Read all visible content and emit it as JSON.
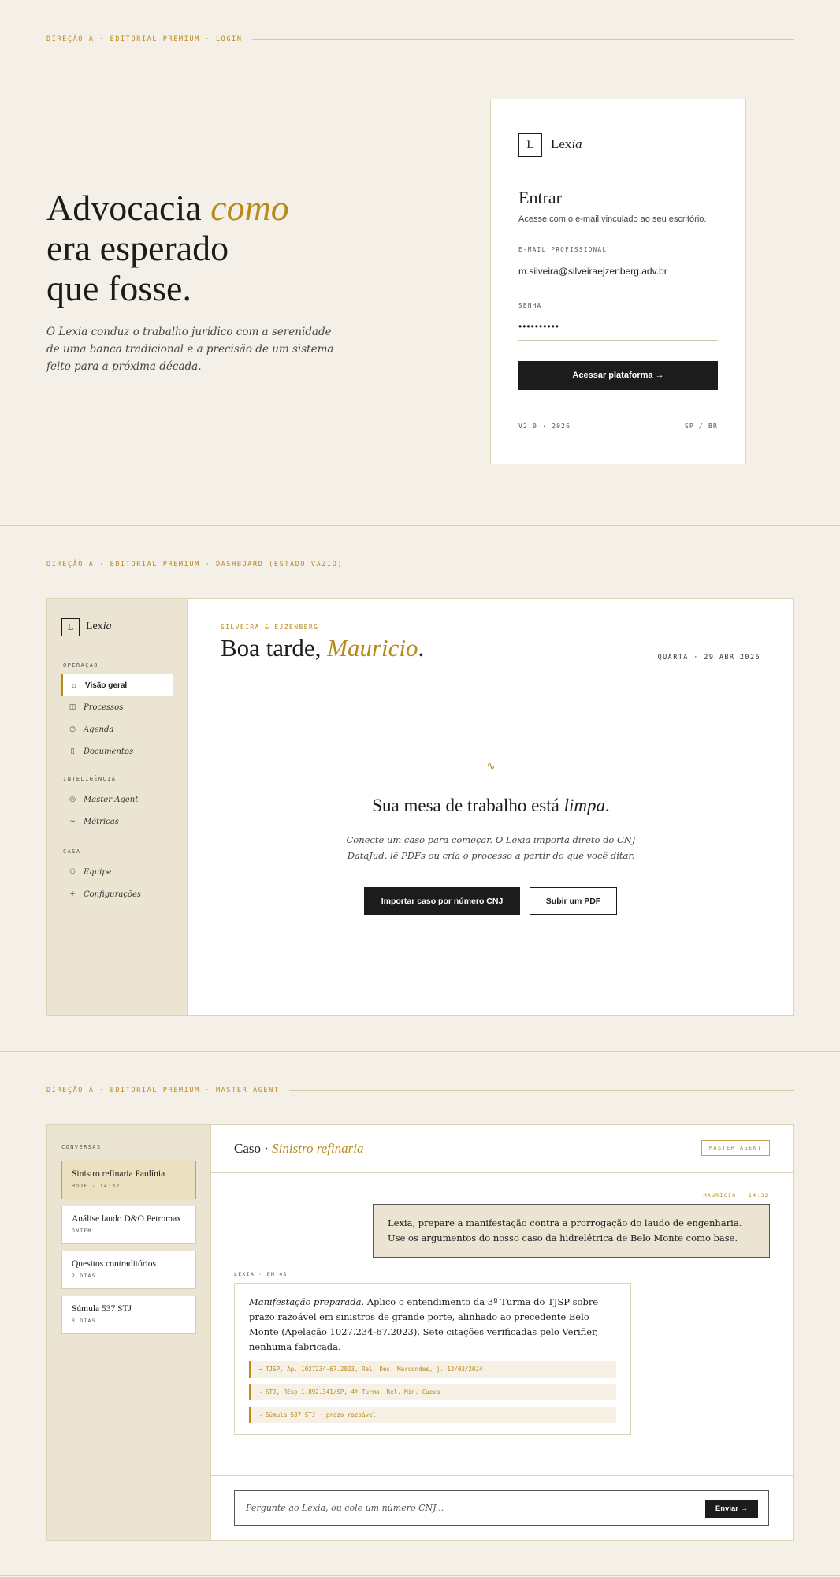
{
  "sections": {
    "login_label": "DIREÇÃO A · EDITORIAL PREMIUM · LOGIN",
    "dashboard_label": "DIREÇÃO A · EDITORIAL PREMIUM · DASHBOARD (ESTADO VAZIO)",
    "agent_label": "DIREÇÃO A · EDITORIAL PREMIUM · MASTER AGENT"
  },
  "hero": {
    "title_1": "Advocacia ",
    "title_accent": "como",
    "title_2": "era esperado",
    "title_3": "que fosse.",
    "subtitle": "O Lexia conduz o trabalho jurídico com a serenidade de uma banca tradicional e a precisão de um sistema feito para a próxima década."
  },
  "brand": {
    "mark": "L",
    "name_main": "Lex",
    "name_accent": "ia"
  },
  "login": {
    "title": "Entrar",
    "description": "Acesse com o e-mail vinculado ao seu escritório.",
    "email_label": "E-MAIL PROFISSIONAL",
    "email_value": "m.silveira@silveiraejzenberg.adv.br",
    "password_label": "SENHA",
    "password_value": "••••••••••",
    "submit": "Acessar plataforma →",
    "version": "V2.0 · 2026",
    "locale": "SP / BR"
  },
  "dashboard": {
    "nav_groups": {
      "operacao": "OPERAÇÃO",
      "inteligencia": "INTELIGÊNCIA",
      "casa": "CASA"
    },
    "nav": {
      "overview": "Visão geral",
      "processes": "Processos",
      "agenda": "Agenda",
      "documents": "Documentos",
      "master_agent": "Master Agent",
      "metrics": "Métricas",
      "team": "Equipe",
      "settings": "Configurações"
    },
    "firm": "SILVEIRA & EJZENBERG",
    "greeting": "Boa tarde, ",
    "user_name": "Mauricio",
    "greeting_end": ".",
    "date": "QUARTA · 29 ABR 2026",
    "empty_icon": "∿",
    "empty_title": "Sua mesa de trabalho está ",
    "empty_title_accent": "limpa",
    "empty_title_end": ".",
    "empty_desc": "Conecte um caso para começar. O Lexia importa direto do CNJ DataJud, lê PDFs ou cria o processo a partir do que você ditar.",
    "import_button": "Importar caso por número CNJ",
    "upload_button": "Subir um PDF"
  },
  "agent": {
    "conversations_label": "CONVERSAS",
    "conversations": [
      {
        "title": "Sinistro refinaria Paulínia",
        "meta": "HOJE · 14:32"
      },
      {
        "title": "Análise laudo D&O Petromax",
        "meta": "ONTEM"
      },
      {
        "title": "Quesitos contraditórios",
        "meta": "2 DIAS"
      },
      {
        "title": "Súmula 537 STJ",
        "meta": "3 DIAS"
      }
    ],
    "case_prefix": "Caso · ",
    "case_name": "Sinistro refinaria",
    "badge": "MASTER AGENT",
    "user_meta": "MAURICIO · 14:32",
    "user_message": "Lexia, prepare a manifestação contra a prorrogação do laudo de engenharia. Use os argumentos do nosso caso da hidrelétrica de Belo Monte como base.",
    "ai_meta": "LEXIA · EM 4S",
    "ai_lead": "Manifestação preparada.",
    "ai_message": " Aplico o entendimento da 3ª Turma do TJSP sobre prazo razoável em sinistros de grande porte, alinhado ao precedente Belo Monte (Apelação 1027.234-67.2023). Sete citações verificadas pelo Verifier, nenhuma fabricada.",
    "citations": [
      "→ TJSP, Ap. 1027234-67.2023, Rel. Des. Marcondes, j. 12/03/2024",
      "→ STJ, REsp 1.892.341/SP, 4ª Turma, Rel. Min. Cueva",
      "→ Súmula 537 STJ · prazo razoável"
    ],
    "input_placeholder": "Pergunte ao Lexia, ou cole um número CNJ...",
    "send": "Enviar →"
  }
}
